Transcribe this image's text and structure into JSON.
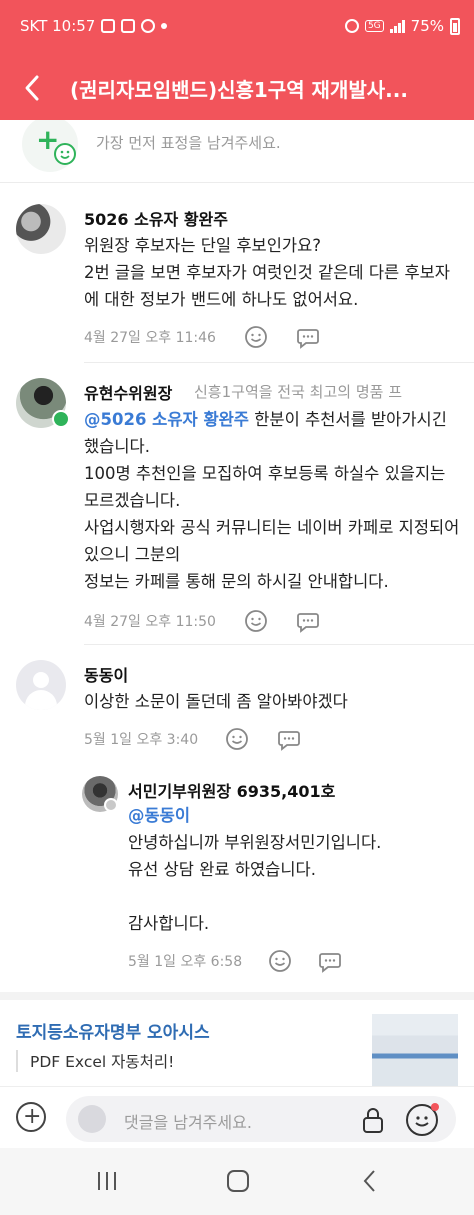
{
  "status_bar": {
    "carrier_time": "SKT 10:57",
    "network": "5G",
    "battery": "75%"
  },
  "header": {
    "title": "(권리자모임밴드)신흥1구역 재개발사..."
  },
  "reaction_prompt": {
    "text": "가장 먼저 표정을 남겨주세요."
  },
  "comments": [
    {
      "author": "5026 소유자 황완주",
      "body": "위원장 후보자는 단일 후보인가요?\n2번 글을 보면 후보자가 여럿인것 같은데 다른 후보자에 대한 정보가 밴드에 하나도 없어서요.",
      "time": "4월 27일 오후 11:46"
    },
    {
      "author": "유현수위원장",
      "author_sub": "신흥1구역을 전국 최고의 명품 프",
      "mention": "@5026 소유자 황완주",
      "body_after_mention": " 한분이 추천서를 받아가시긴 했습니다.\n100명 추천인을 모집하여 후보등록 하실수 있을지는 모르겠습니다.\n사업시행자와 공식 커뮤니티는 네이버 카페로 지정되어있으니 그분의\n정보는 카페를 통해 문의 하시길 안내합니다.",
      "time": "4월 27일 오후 11:50"
    },
    {
      "author": "동동이",
      "body": "이상한 소문이 돌던데  좀 알아봐야겠다",
      "time": "5월 1일 오후 3:40"
    }
  ],
  "reply": {
    "author": "서민기부위원장 6935,401호",
    "mention": "@동동이",
    "body": "안녕하십니까 부위원장서민기입니다.\n유선 상담 완료 하였습니다.\n\n감사합니다.",
    "time": "5월 1일 오후 6:58"
  },
  "ad": {
    "title": "토지등소유자명부 오아시스",
    "description": "PDF Excel 자동처리!"
  },
  "input_bar": {
    "placeholder": "댓글을 남겨주세요."
  },
  "colors": {
    "accent": "#f2545b",
    "mention": "#3a7bd5",
    "green": "#2fb35a"
  }
}
